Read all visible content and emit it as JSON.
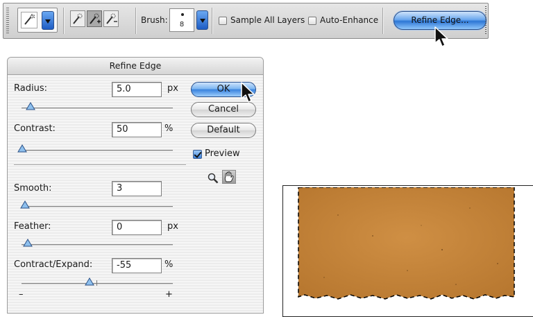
{
  "options_bar": {
    "brush_label": "Brush:",
    "brush_size": "8",
    "sample_all_layers_label": "Sample All Layers",
    "sample_all_layers_checked": false,
    "auto_enhance_label": "Auto-Enhance",
    "auto_enhance_checked": false,
    "refine_edge_button": "Refine Edge..."
  },
  "dialog": {
    "title": "Refine Edge",
    "fields": {
      "radius": {
        "label": "Radius:",
        "value": "5.0",
        "unit": "px"
      },
      "contrast": {
        "label": "Contrast:",
        "value": "50",
        "unit": "%"
      },
      "smooth": {
        "label": "Smooth:",
        "value": "3",
        "unit": ""
      },
      "feather": {
        "label": "Feather:",
        "value": "0",
        "unit": "px"
      },
      "contract_expand": {
        "label": "Contract/Expand:",
        "value": "-55",
        "unit": "%"
      }
    },
    "minus_label": "–",
    "plus_label": "+",
    "buttons": {
      "ok": "OK",
      "cancel": "Cancel",
      "default": "Default"
    },
    "preview_label": "Preview",
    "preview_checked": true
  },
  "colors": {
    "accent_blue": "#3a83df",
    "cardboard": "#c8873c"
  },
  "icons": [
    "quick-selection-tool-icon",
    "new-selection-icon",
    "add-to-selection-icon",
    "subtract-from-selection-icon",
    "zoom-icon",
    "hand-icon",
    "pointer-cursor-icon"
  ]
}
